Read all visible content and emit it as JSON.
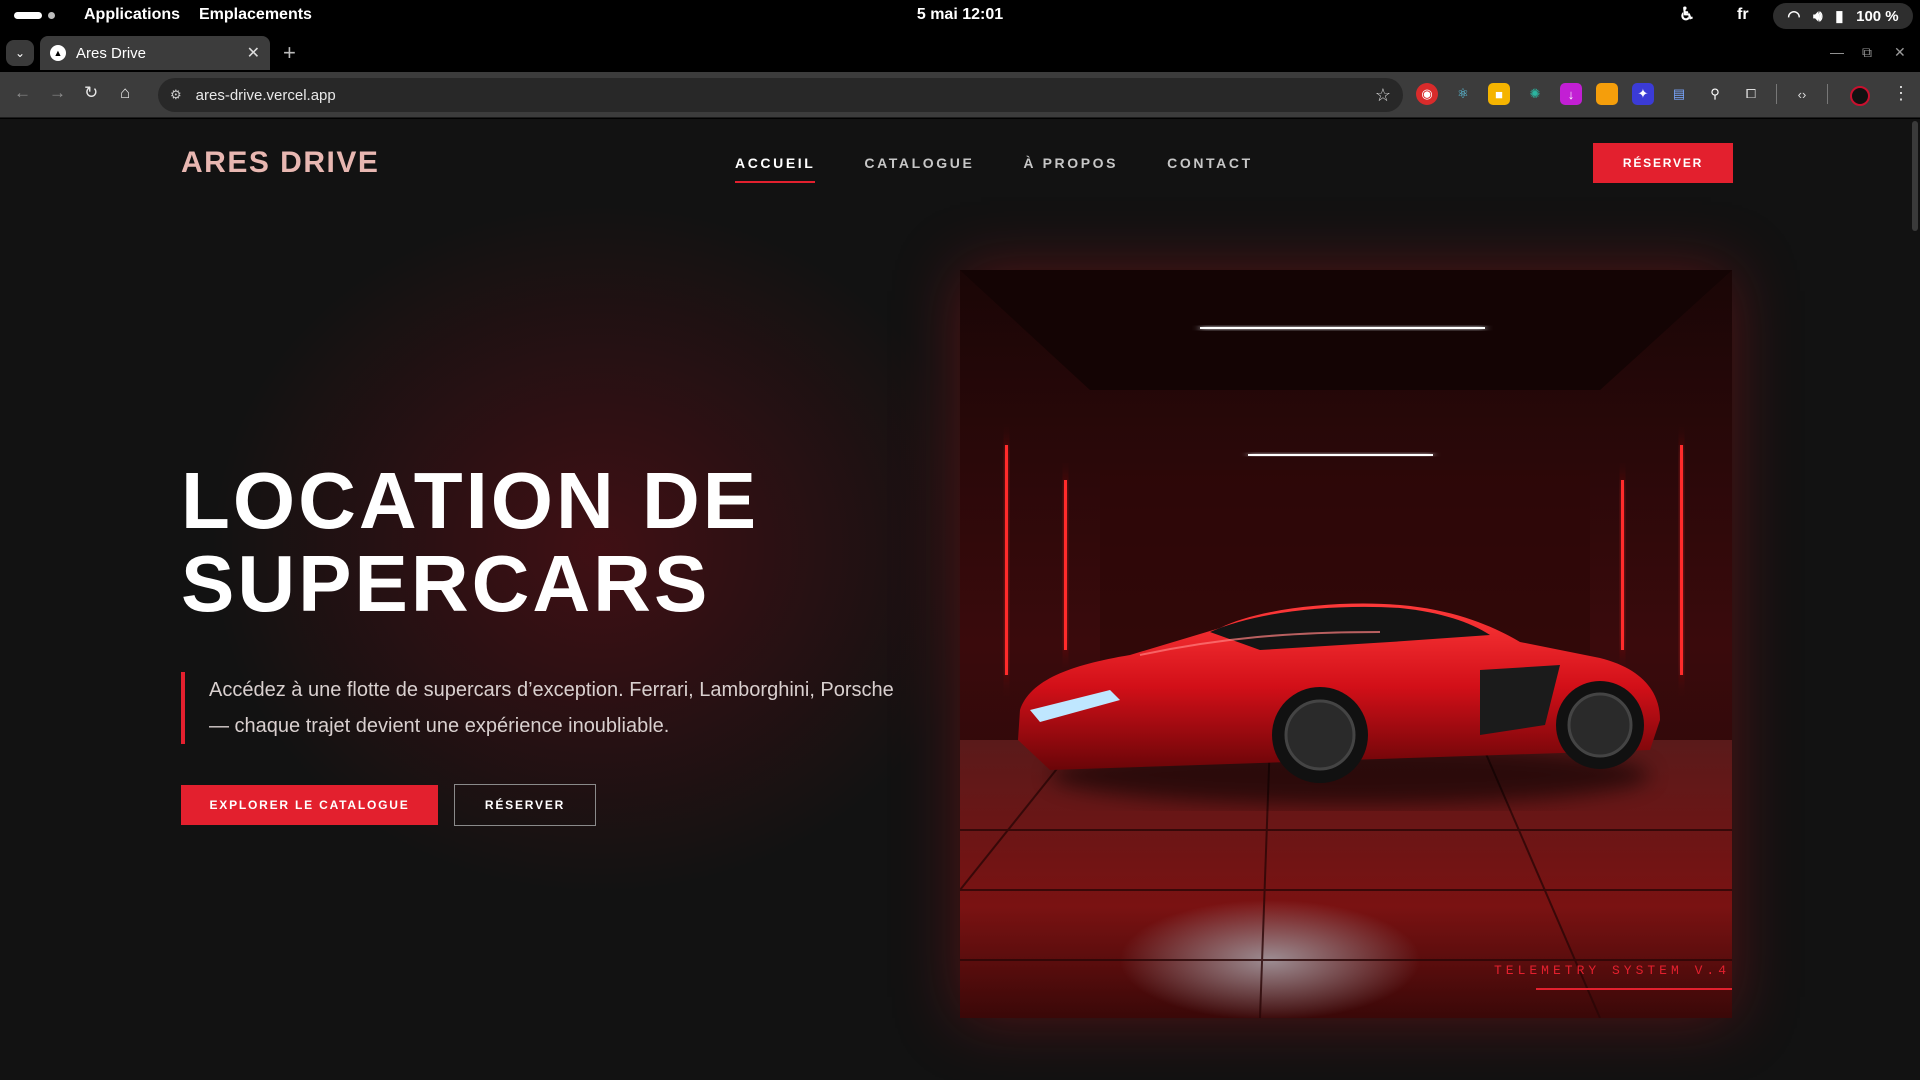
{
  "system_bar": {
    "applications": "Applications",
    "places": "Emplacements",
    "clock": "5 mai  12:01",
    "language": "fr",
    "battery": "100 %"
  },
  "browser": {
    "tab_title": "Ares Drive",
    "url": "ares-drive.vercel.app"
  },
  "site": {
    "logo": "ARES DRIVE",
    "nav": [
      {
        "label": "ACCUEIL",
        "active": true
      },
      {
        "label": "CATALOGUE",
        "active": false
      },
      {
        "label": "À PROPOS",
        "active": false
      },
      {
        "label": "CONTACT",
        "active": false
      }
    ],
    "nav_cta": "RÉSERVER",
    "hero": {
      "title_line1": "LOCATION DE",
      "title_line2": "SUPERCARS",
      "description": "Accédez à une flotte de supercars d’exception. Ferrari, Lamborghini, Porsche — chaque trajet devient une expérience inoubliable.",
      "primary_cta": "EXPLORER LE CATALOGUE",
      "secondary_cta": "RÉSERVER",
      "image_overlay": "TELEMETRY SYSTEM V.4"
    }
  },
  "colors": {
    "accent": "#e3202e",
    "logo": "#e8b7b1",
    "page_background": "#121212"
  }
}
